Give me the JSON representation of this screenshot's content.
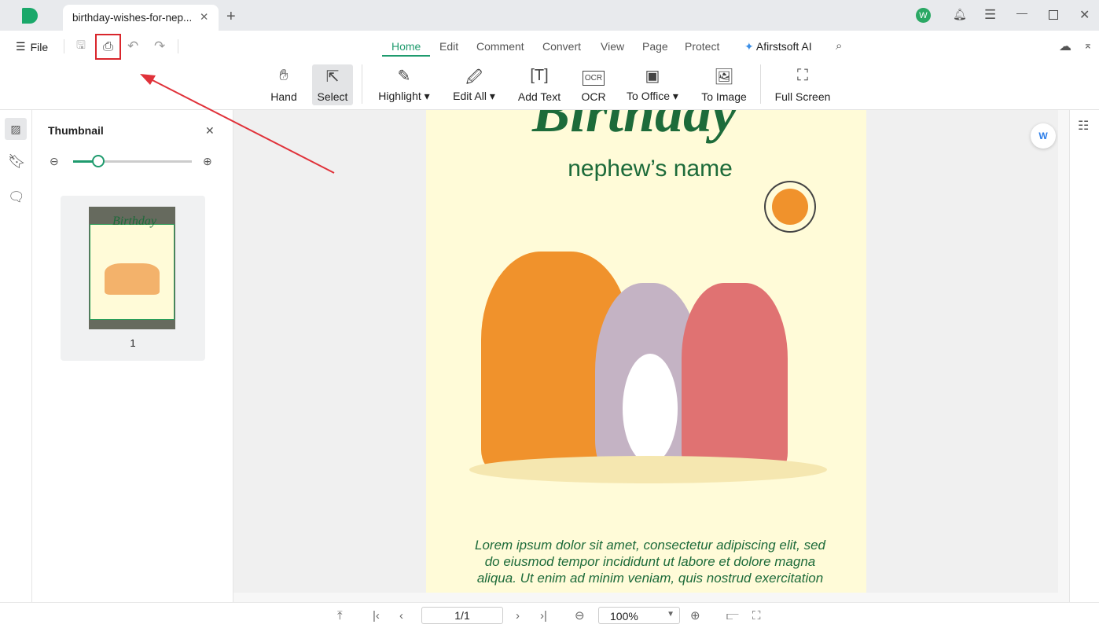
{
  "tab": {
    "title": "birthday-wishes-for-nep...",
    "avatar": "W"
  },
  "quick": {
    "file": "File"
  },
  "menu": [
    {
      "label": "Home",
      "active": true
    },
    {
      "label": "Edit"
    },
    {
      "label": "Comment"
    },
    {
      "label": "Convert"
    },
    {
      "label": "View"
    },
    {
      "label": "Page"
    },
    {
      "label": "Protect"
    }
  ],
  "ai_label": "Afirstsoft AI",
  "tools": [
    {
      "label": "Hand",
      "icon": "hand-icon"
    },
    {
      "label": "Select",
      "icon": "cursor-icon",
      "active": true
    },
    {
      "label": "Highlight",
      "icon": "highlighter-icon",
      "dropdown": true
    },
    {
      "label": "Edit All",
      "icon": "edit-icon",
      "dropdown": true
    },
    {
      "label": "Add Text",
      "icon": "add-text-icon"
    },
    {
      "label": "OCR",
      "icon": "ocr-icon"
    },
    {
      "label": "To Office",
      "icon": "office-icon",
      "dropdown": true
    },
    {
      "label": "To Image",
      "icon": "image-icon"
    },
    {
      "label": "Full Screen",
      "icon": "fullscreen-icon"
    }
  ],
  "thumbnail": {
    "title": "Thumbnail",
    "zoom": 0.2,
    "page_number": "1"
  },
  "pdf": {
    "heading": "Birthday",
    "subtitle": "nephew’s name",
    "body": [
      "Lorem ipsum dolor sit amet, consectetur adipiscing elit, sed",
      "do eiusmod tempor incididunt ut labore et dolore magna",
      "aliqua. Ut enim ad minim veniam, quis nostrud exercitation"
    ]
  },
  "bottom": {
    "page": "1/1",
    "zoom": "100%"
  },
  "colors": {
    "accent": "#1f9b6e",
    "highlight_box": "#d9262c",
    "annotation_arrow": "#e0323a"
  }
}
